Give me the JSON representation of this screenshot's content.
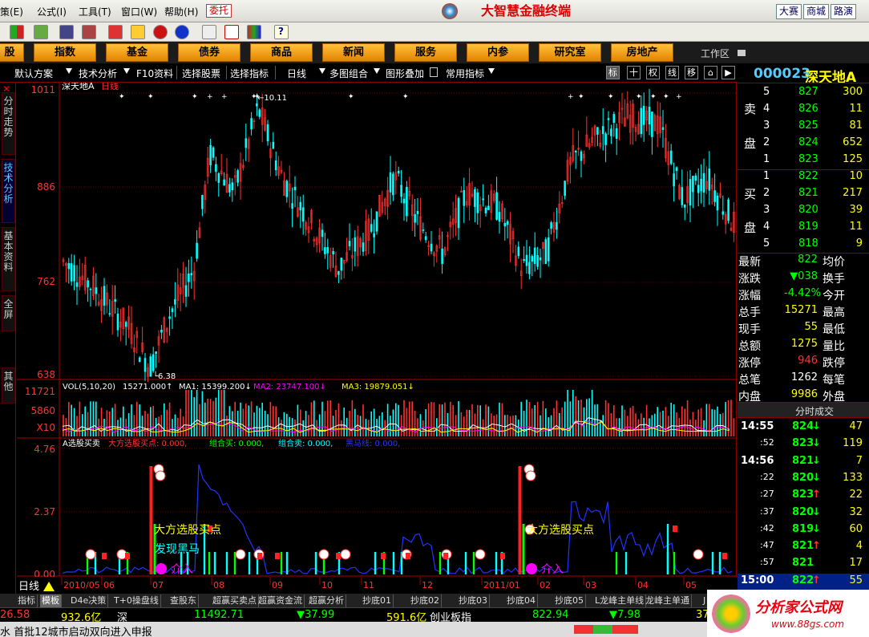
{
  "menu": {
    "items": [
      "策(E)",
      "公式(I)",
      "工具(T)",
      "窗口(W)",
      "帮助(H)"
    ],
    "entrust": "委托",
    "app_title": "大智慧金融终端",
    "right_buttons": [
      "大赛",
      "商城",
      "路演"
    ]
  },
  "nav": {
    "buttons": [
      "股",
      "指数",
      "基金",
      "债券",
      "商品",
      "新闻",
      "服务",
      "内参",
      "研究室",
      "房地产"
    ],
    "workspace": "工作区"
  },
  "subbar": {
    "items": [
      "默认方案",
      "技术分析",
      "F10资料",
      "选择股票",
      "选择指标",
      "日线",
      "多图组合",
      "图形叠加",
      "常用指标"
    ],
    "right_icons": [
      "标",
      "十",
      "权",
      "线",
      "移"
    ]
  },
  "left_tabs": [
    "分时走势",
    "技术分析",
    "基本资料",
    "全屏",
    "其他"
  ],
  "chart": {
    "stock_label": "深天地A",
    "period": "日线",
    "price_ticks": [
      "1011",
      "886",
      "762",
      "638"
    ],
    "high_marker": "10.11",
    "low_marker": "6.38",
    "vol_ticks": [
      "11721",
      "5860",
      "X10"
    ],
    "vol_legend": {
      "prefix": "VOL(5,10,20)",
      "v": "15271.000",
      "ma1": "MA1: 15399.200",
      "ma2": "MA2: 23747.100",
      "ma3": "MA3: 19879.051"
    },
    "ind_ticks": [
      "4.76",
      "2.37",
      "0.00"
    ],
    "ind_legend": {
      "name": "A选股买卖",
      "l1": "大方选股买点: 0.000,",
      "l2": "组合买: 0.000,",
      "l3": "组合卖: 0.000,",
      "l4": "黑马线: 0.000,"
    },
    "annotations": {
      "buy1": "大方选股买点",
      "horse": "发现黑马",
      "enter1": "介入",
      "buy2": "大方选股买点",
      "enter2": "介入"
    },
    "date_axis": [
      "2010/05",
      "06",
      "07",
      "08",
      "09",
      "10",
      "11",
      "12",
      "2011/01",
      "02",
      "03",
      "04",
      "05"
    ],
    "period_footer": "日线"
  },
  "right": {
    "code": "000023",
    "name": "深天地A",
    "sell_label": [
      "卖",
      "盘"
    ],
    "buy_label": [
      "买",
      "盘"
    ],
    "asks": [
      {
        "lvl": "5",
        "price": "827",
        "vol": "300"
      },
      {
        "lvl": "4",
        "price": "826",
        "vol": "11"
      },
      {
        "lvl": "3",
        "price": "825",
        "vol": "81"
      },
      {
        "lvl": "2",
        "price": "824",
        "vol": "652"
      },
      {
        "lvl": "1",
        "price": "823",
        "vol": "125"
      }
    ],
    "bids": [
      {
        "lvl": "1",
        "price": "822",
        "vol": "10"
      },
      {
        "lvl": "2",
        "price": "821",
        "vol": "217"
      },
      {
        "lvl": "3",
        "price": "820",
        "vol": "39"
      },
      {
        "lvl": "4",
        "price": "819",
        "vol": "11"
      },
      {
        "lvl": "5",
        "price": "818",
        "vol": "9"
      }
    ],
    "stats": [
      {
        "k": "最新",
        "v": "822",
        "k2": "均价"
      },
      {
        "k": "涨跌",
        "v": "▼038",
        "k2": "换手"
      },
      {
        "k": "涨幅",
        "v": "-4.42%",
        "k2": "今开"
      },
      {
        "k": "总手",
        "v": "15271",
        "k2": "最高"
      },
      {
        "k": "现手",
        "v": "55",
        "k2": "最低"
      },
      {
        "k": "总额",
        "v": "1275",
        "k2": "量比"
      },
      {
        "k": "涨停",
        "v": "946",
        "k2": "跌停"
      },
      {
        "k": "总笔",
        "v": "1262",
        "k2": "每笔"
      },
      {
        "k": "内盘",
        "v": "9986",
        "k2": "外盘"
      }
    ],
    "trades_title": "分时成交",
    "trades": [
      {
        "t": "14:55",
        "p": "824",
        "d": "↓",
        "v": "47"
      },
      {
        "t": ":52",
        "p": "823",
        "d": "↓",
        "v": "119"
      },
      {
        "t": "14:56",
        "p": "821",
        "d": "↓",
        "v": "7"
      },
      {
        "t": ":22",
        "p": "820",
        "d": "↓",
        "v": "133"
      },
      {
        "t": ":27",
        "p": "823",
        "d": "↑",
        "v": "22"
      },
      {
        "t": ":37",
        "p": "820",
        "d": "↓",
        "v": "32"
      },
      {
        "t": ":42",
        "p": "819",
        "d": "↓",
        "v": "60"
      },
      {
        "t": ":47",
        "p": "821",
        "d": "↑",
        "v": "4"
      },
      {
        "t": ":57",
        "p": "821",
        "d": "",
        "v": "17"
      },
      {
        "t": "15:00",
        "p": "822",
        "d": "↑",
        "v": "55"
      }
    ]
  },
  "bottom_tabs": [
    "指标",
    "模板",
    "D4e决策",
    "T+0操盘线",
    "查股东",
    "超赢买卖点",
    "超赢资金流",
    "超赢分析",
    "抄底01",
    "抄底02",
    "抄底03",
    "抄底04",
    "抄底05",
    "L龙峰主单线",
    "龙峰主单通",
    "J"
  ],
  "ticker": {
    "a": "26.58",
    "b": "932.6亿",
    "c": "深",
    "d": "11492.71",
    "e": "▼37.99",
    "f": "591.6亿",
    "g": "创业板指",
    "h": "822.94",
    "i": "▼7.98",
    "j": "37"
  },
  "news": "水 首批12城市启动双向进入申报",
  "watermark": {
    "text": "分析家公式网",
    "url": "www.88gs.com"
  },
  "colors": {
    "up": "#ff3030",
    "down": "#00ffff",
    "bg": "#000000",
    "nav": "#f0a000"
  }
}
